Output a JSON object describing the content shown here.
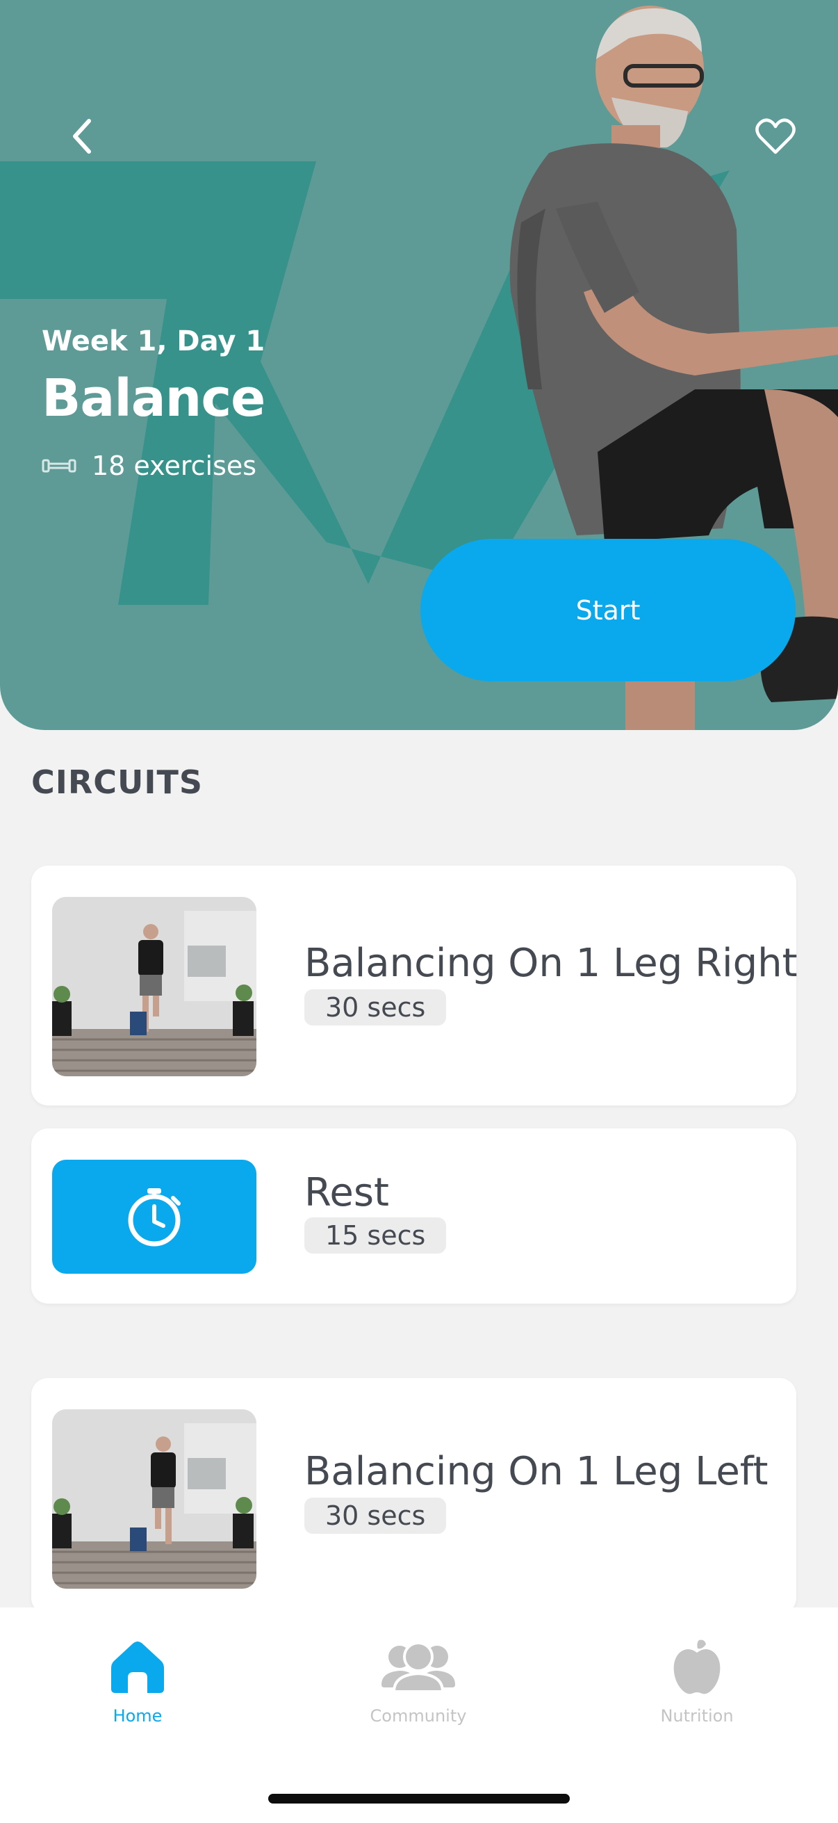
{
  "hero": {
    "week_day": "Week 1, Day 1",
    "title": "Balance",
    "exercise_count": "18 exercises",
    "start_label": "Start",
    "back_icon": "chevron-left-icon",
    "favorite_icon": "heart-outline-icon",
    "background_color": "#5e9b96",
    "accent_color": "#0aa8ec"
  },
  "circuits": {
    "heading": "CIRCUITS",
    "items": [
      {
        "name": "Balancing On 1 Leg Right",
        "duration": "30 secs",
        "thumbnail": "exercise-photo"
      },
      {
        "name": "Rest",
        "duration": "15 secs",
        "thumbnail": "stopwatch-icon"
      },
      {
        "name": "Balancing On 1 Leg Left",
        "duration": "30 secs",
        "thumbnail": "exercise-photo"
      }
    ]
  },
  "tabbar": {
    "tabs": [
      {
        "label": "Home",
        "icon": "home-icon",
        "active": true
      },
      {
        "label": "Community",
        "icon": "community-icon",
        "active": false
      },
      {
        "label": "Nutrition",
        "icon": "apple-icon",
        "active": false
      }
    ],
    "active_color": "#0aa8ec",
    "inactive_color": "#c4c4c4"
  }
}
